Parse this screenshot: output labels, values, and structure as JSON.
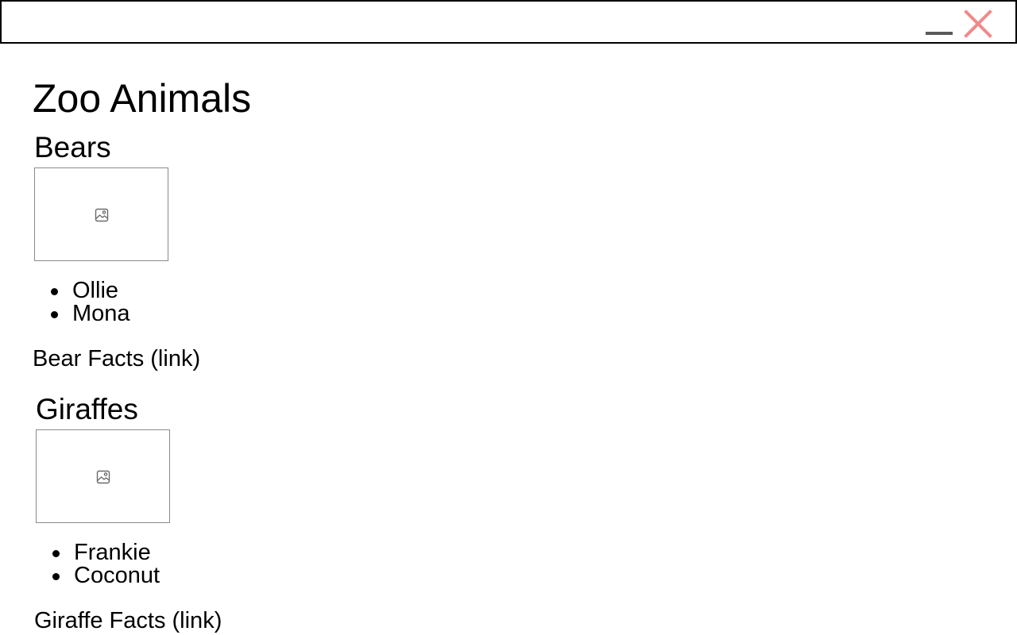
{
  "window": {
    "minimize_icon": "minimize-icon",
    "close_icon": "close-icon",
    "close_color": "#f08a8a",
    "minimize_color": "#5a5a5a"
  },
  "page": {
    "title": "Zoo Animals"
  },
  "sections": [
    {
      "title": "Bears",
      "image_icon": "image-placeholder-icon",
      "animals": [
        "Ollie",
        "Mona"
      ],
      "link_label": "Bear Facts (link)"
    },
    {
      "title": "Giraffes",
      "image_icon": "image-placeholder-icon",
      "animals": [
        "Frankie",
        "Coconut"
      ],
      "link_label": "Giraffe Facts (link)"
    }
  ]
}
